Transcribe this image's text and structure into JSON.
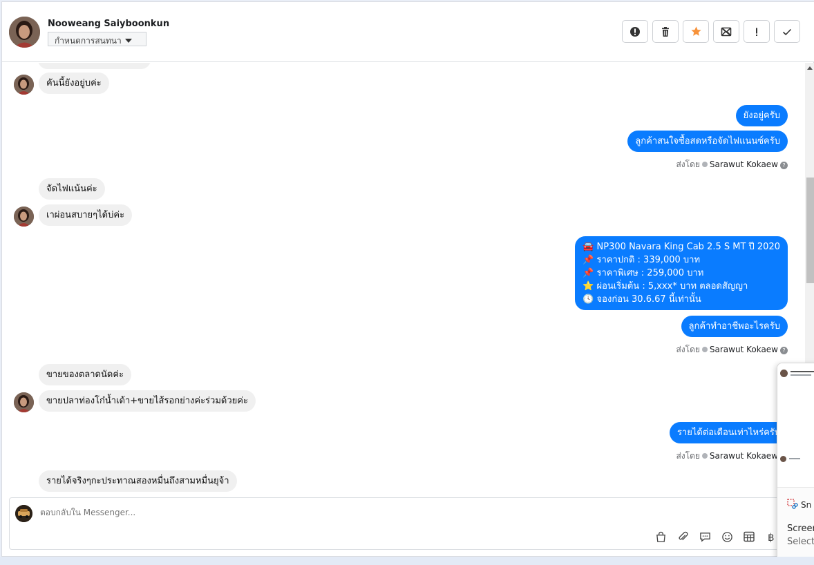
{
  "header": {
    "name": "Nooweang Saiyboonkun",
    "label_select": "กำหนดการสนทนา"
  },
  "messages": {
    "m1": "คันนี้ยังอยู่บค่ะ",
    "m2": "ยังอยู่ครับ",
    "m3": "ลูกค้าสนใจซื้อสดหรือจัดไฟแนนซ์ครับ",
    "m4": "จัดไฟแน้นค่ะ",
    "m5": "เาผ่อนสบายๆได้บ่ค่ะ",
    "promo_lines": [
      "🚘 NP300 Navara King Cab 2.5 S MT ปี 2020",
      "📌 ราคาปกติ : 339,000 บาท",
      "📌 ราคาพิเศษ : 259,000 บาท",
      "⭐ ผ่อนเริ่มต้น : 5,xxx* บาท ตลอดสัญญา",
      "🕓 จองก่อน 30.6.67 นี้เท่านั้น"
    ],
    "m7": "ลูกค้าทำอาชีพอะไรครับ",
    "m8": "ขายของตลาดนัดค่ะ",
    "m9": "ขายปลาท่องโก๋น้ำเต้า+ขายไส้รอกย่างค่ะร่วมด้วยค่ะ",
    "m10": "รายได้ต่อเดือนเท่าไหร่ครับ",
    "m11": "รายได้จริงๆกะประทาณสองหมื่นถึงสามหมื่นยุจ้า"
  },
  "sent_by": {
    "prefix": "ส่งโดย",
    "agent": "Sarawut Kokaew"
  },
  "composer": {
    "placeholder": "ตอบกลับใน Messenger..."
  },
  "overlay": {
    "snip_label": "Sn",
    "title": "Screen",
    "subtitle": "Select"
  },
  "icons": {
    "actions": [
      "alert-icon",
      "trash-icon",
      "star-icon",
      "mail-block-icon",
      "exclamation-icon",
      "check-icon"
    ],
    "tools": [
      "bag-icon",
      "paperclip-icon",
      "chat-icon",
      "emoji-icon",
      "table-icon",
      "baht-icon"
    ]
  },
  "colors": {
    "outgoing_bubble": "#0a7cff",
    "incoming_bubble": "#f0f0f0",
    "star": "#f7923a"
  }
}
